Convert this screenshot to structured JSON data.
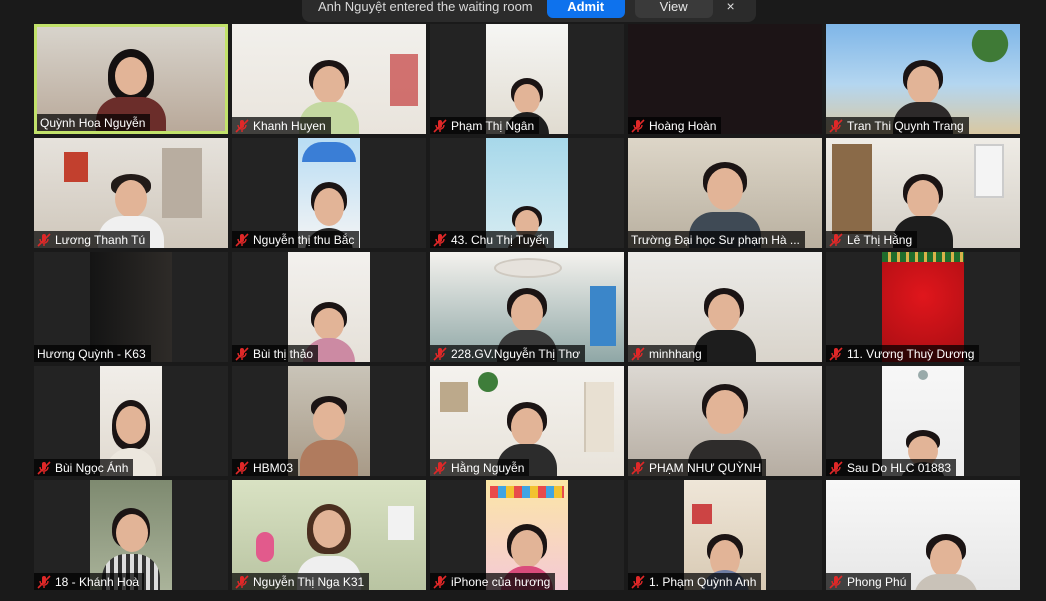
{
  "banner": {
    "message": "Anh Nguyệt entered the waiting room",
    "admit_label": "Admit",
    "view_label": "View",
    "close_glyph": "×"
  },
  "colors": {
    "active_speaker_border": "#c2e26b",
    "mute_icon": "#e02828",
    "admit_button": "#0e72ed"
  },
  "participants": [
    {
      "name": "Quỳnh Hoa Nguyễn",
      "muted": false,
      "active": true
    },
    {
      "name": "Khanh Huyen",
      "muted": true
    },
    {
      "name": "Phạm  Thị Ngân",
      "muted": true
    },
    {
      "name": "Hoàng Hoàn",
      "muted": true
    },
    {
      "name": "Tran Thi Quynh Trang",
      "muted": true
    },
    {
      "name": "Lương Thanh Tú",
      "muted": true
    },
    {
      "name": "Nguyễn thị thu Bắc",
      "muted": true
    },
    {
      "name": "43. Chu Thị Tuyến",
      "muted": true
    },
    {
      "name": "Trường Đại học Sư phạm Hà ...",
      "muted": false,
      "speaking": true
    },
    {
      "name": "Lê Thị Hằng",
      "muted": true
    },
    {
      "name": "Hương Quỳnh - K63",
      "muted": false
    },
    {
      "name": "Bùi thị thảo",
      "muted": true
    },
    {
      "name": "228.GV.Nguyễn Thị Thơ",
      "muted": true
    },
    {
      "name": "minhhang",
      "muted": true
    },
    {
      "name": "11. Vương Thuỳ Dương",
      "muted": true
    },
    {
      "name": "Bùi Ngọc Ánh",
      "muted": true
    },
    {
      "name": "HBM03",
      "muted": true
    },
    {
      "name": "Hằng Nguyễn",
      "muted": true
    },
    {
      "name": "PHẠM NHƯ QUỲNH",
      "muted": true
    },
    {
      "name": "Sau Do HLC 01883",
      "muted": true
    },
    {
      "name": "18 - Khánh Hoà",
      "muted": true
    },
    {
      "name": "Nguyễn Thị Nga K31",
      "muted": true
    },
    {
      "name": "iPhone của hương",
      "muted": true
    },
    {
      "name": "1. Phạm Quỳnh Anh",
      "muted": true
    },
    {
      "name": "Phong Phú",
      "muted": true
    }
  ]
}
